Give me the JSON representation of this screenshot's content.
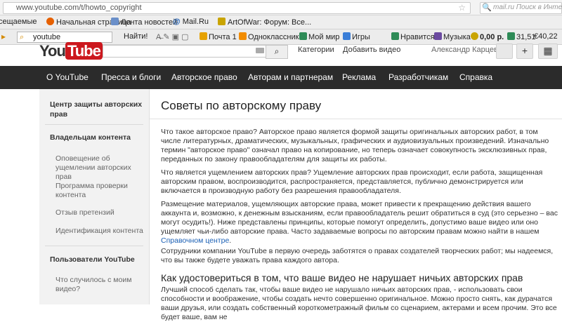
{
  "browser": {
    "url": "www.youtube.com/t/howto_copyright",
    "search_placeholder": "mail.ru Поиск в Инте",
    "bookmarks": [
      {
        "label": "сещаемые",
        "icon": "page-icon",
        "color": "#888888"
      },
      {
        "label": "Начальная страница",
        "icon": "firefox-icon",
        "color": "#e66000"
      },
      {
        "label": "Лента новостей",
        "icon": "rss-icon",
        "color": "#6a8fc9"
      },
      {
        "label": "Mail.Ru",
        "icon": "at-icon",
        "color": "#1f5fb4"
      },
      {
        "label": "ArtOfWar: Форум: Все...",
        "icon": "star-icon",
        "color": "#c9a400"
      }
    ],
    "toolbar": {
      "search_value": "youtube",
      "find_button": "Найти!",
      "items": [
        {
          "label": "Почта 1",
          "icon": "mail-icon",
          "color": "#e6a100"
        },
        {
          "label": "Одноклассники",
          "icon": "ok-icon",
          "color": "#f28c00"
        },
        {
          "label": "Мой мир",
          "icon": "myworld-icon",
          "color": "#2e8b57"
        },
        {
          "label": "Игры",
          "icon": "games-icon",
          "color": "#3a7ed8"
        },
        {
          "label": "Нравится",
          "icon": "like-icon",
          "color": "#2e8b57"
        },
        {
          "label": "Музыка",
          "icon": "music-icon",
          "color": "#6b4aa0"
        },
        {
          "label": "0,00 р.",
          "icon": "money-icon",
          "color": "#c9a400"
        },
        {
          "label": "31,51",
          "icon": "dollar-icon",
          "color": "#2e8b57"
        },
        {
          "label": "€40,22",
          "icon": "euro-icon",
          "color": "#c94a00"
        }
      ]
    }
  },
  "yt_header": {
    "logo_you": "You",
    "logo_tube": "Tube",
    "categories": "Категории",
    "add_video": "Добавить видео",
    "user": "Александр Карцев",
    "plus": "+"
  },
  "nav": [
    "О YouTube",
    "Пресса и блоги",
    "Авторское право",
    "Авторам и партнерам",
    "Реклама",
    "Разработчикам",
    "Справка"
  ],
  "sidebar": {
    "section1": "Центр защиты авторских прав",
    "section2": "Владельцам контента",
    "items2": [
      "Оповещение об ущемлении авторских прав",
      "Программа проверки контента",
      "Отзыв претензий",
      "Идентификация контента"
    ],
    "section3": "Пользователи YouTube",
    "items3": [
      "Что случилось с моим видео?"
    ]
  },
  "main": {
    "title": "Советы по авторскому праву",
    "p1": "Что такое авторское право? Авторское право является формой защиты оригинальных авторских работ, в том числе литературных, драматических, музыкальных, графических и аудиовизуальных произведений. Изначально термин \"авторское право\" означал право на копирование, но теперь означает совокупность эксклюзивных прав, переданных по закону правообладателям для защиты их работы.",
    "p2": "Что является ущемлением авторских прав? Ущемление авторских прав происходит, если работа, защищенная авторским правом, воспроизводится, распространяется, представляется, публично демонстрируется или включается в производную работу без разрешения правообладателя.",
    "p3": "Размещение материалов, ущемляющих авторские права, может привести к прекращению действия вашего аккаунта и, возможно, к денежным взысканиям, если правообладатель решит обратиться в суд (это серьезно – вас могут осудить!). Ниже представлены принципы, которые помогут определить, допустимо ваше видео или оно ущемляет чьи-либо авторские права. Часто задаваемые вопросы по авторским правам можно найти в нашем ",
    "p3_link": "Справочном центре",
    "p3_end": ".",
    "p4": "Сотрудники компании YouTube в первую очередь заботятся о правах создателей творческих работ; мы надеемся, что вы также будете уважать права каждого автора.",
    "h2": "Как удостовериться в том, что ваше видео не нарушает ничьих авторских прав",
    "p5": "Лучший способ сделать так, чтобы ваше видео не нарушало ничьих авторских прав, - использовать свои способности и воображение, чтобы создать нечто совершенно оригинальное. Можно просто снять, как дурачатся ваши друзья, или создать собственный короткометражный фильм со сценарием, актерами и всем прочим. Это все будет ваше, вам не"
  }
}
